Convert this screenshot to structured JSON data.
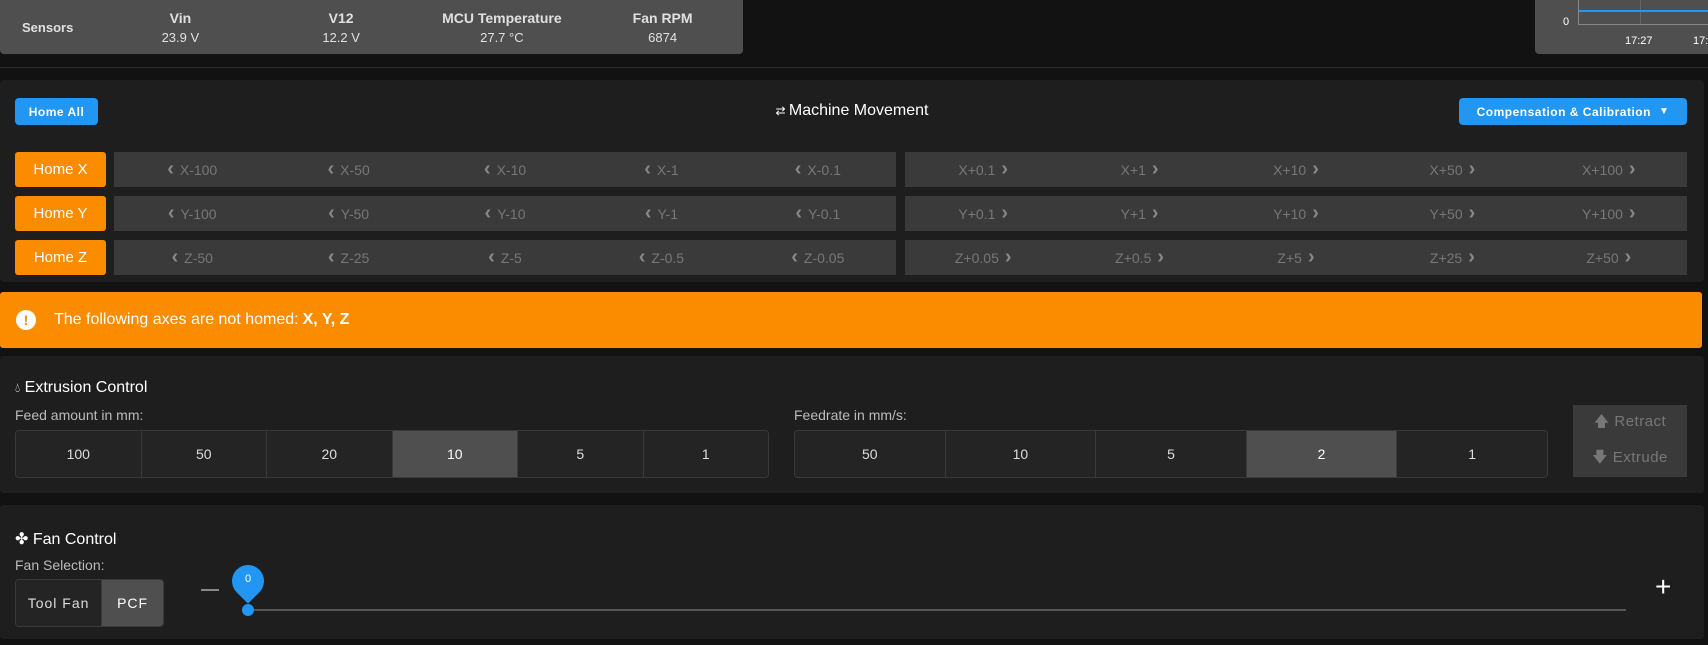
{
  "sensors": {
    "label": "Sensors",
    "columns": [
      {
        "name": "Vin",
        "value": "23.9 V"
      },
      {
        "name": "V12",
        "value": "12.2 V"
      },
      {
        "name": "MCU Temperature",
        "value": "27.7 °C"
      },
      {
        "name": "Fan RPM",
        "value": "6874"
      }
    ]
  },
  "mini_chart": {
    "y_tick": "0",
    "x_ticks": [
      "17:27",
      "17:"
    ],
    "series_color": "#2196f3"
  },
  "movement": {
    "title": "Machine Movement",
    "title_icon": "arrows-swap-icon",
    "home_all": "Home All",
    "compensation": "Compensation & Calibration",
    "rows": [
      {
        "home": "Home X",
        "minus": [
          "X-100",
          "X-50",
          "X-10",
          "X-1",
          "X-0.1"
        ],
        "plus": [
          "X+0.1",
          "X+1",
          "X+10",
          "X+50",
          "X+100"
        ]
      },
      {
        "home": "Home Y",
        "minus": [
          "Y-100",
          "Y-50",
          "Y-10",
          "Y-1",
          "Y-0.1"
        ],
        "plus": [
          "Y+0.1",
          "Y+1",
          "Y+10",
          "Y+50",
          "Y+100"
        ]
      },
      {
        "home": "Home Z",
        "minus": [
          "Z-50",
          "Z-25",
          "Z-5",
          "Z-0.5",
          "Z-0.05"
        ],
        "plus": [
          "Z+0.05",
          "Z+0.5",
          "Z+5",
          "Z+25",
          "Z+50"
        ]
      }
    ]
  },
  "alert": {
    "text": "The following axes are not homed: ",
    "axes": "X, Y, Z",
    "color": "#fb8c00"
  },
  "extrusion": {
    "title": "Extrusion Control",
    "feed_label": "Feed amount in mm:",
    "feed_options": [
      "100",
      "50",
      "20",
      "10",
      "5",
      "1"
    ],
    "feed_selected": "10",
    "rate_label": "Feedrate in mm/s:",
    "rate_options": [
      "50",
      "10",
      "5",
      "2",
      "1"
    ],
    "rate_selected": "2",
    "retract": "Retract",
    "extrude": "Extrude"
  },
  "fan": {
    "title": "Fan Control",
    "selection_label": "Fan Selection:",
    "options": [
      "Tool Fan",
      "PCF"
    ],
    "selected": "PCF",
    "value": "0",
    "value_percent": 0
  },
  "colors": {
    "accent": "#2196f3",
    "warning": "#fb8c00"
  }
}
